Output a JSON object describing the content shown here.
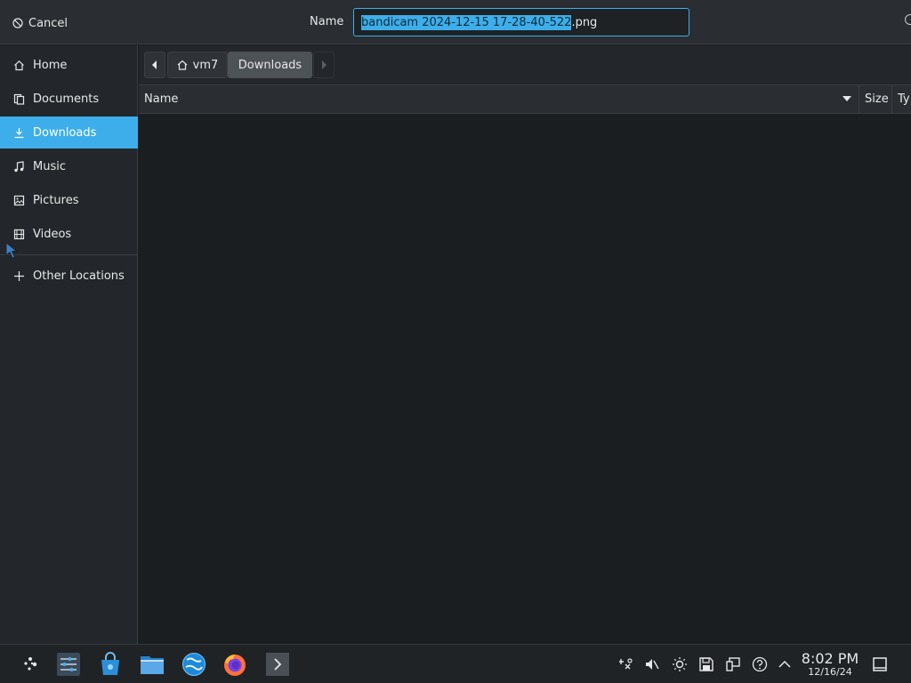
{
  "header": {
    "cancel_label": "Cancel",
    "name_label": "Name",
    "filename_selected": "bandicam 2024-12-15 17-28-40-522",
    "filename_ext": ".png"
  },
  "sidebar": {
    "items": [
      {
        "label": "Home",
        "icon": "home-icon"
      },
      {
        "label": "Documents",
        "icon": "documents-icon"
      },
      {
        "label": "Downloads",
        "icon": "download-icon",
        "active": true
      },
      {
        "label": "Music",
        "icon": "music-icon"
      },
      {
        "label": "Pictures",
        "icon": "pictures-icon"
      },
      {
        "label": "Videos",
        "icon": "videos-icon"
      }
    ],
    "other_locations": "Other Locations"
  },
  "pathbar": {
    "home_crumb": "vm7",
    "current_crumb": "Downloads"
  },
  "columns": {
    "name": "Name",
    "size": "Size",
    "type": "Ty"
  },
  "taskbar": {
    "time": "8:02 PM",
    "date": "12/16/24"
  },
  "colors": {
    "accent": "#3daee9",
    "background": "#1b1e20",
    "panel": "#23272b"
  }
}
